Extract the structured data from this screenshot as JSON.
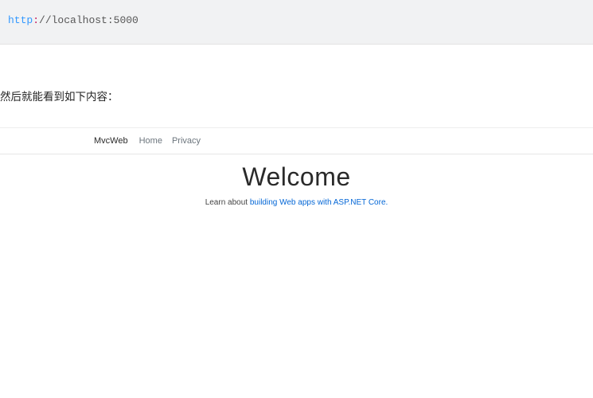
{
  "url": {
    "scheme": "http",
    "colon": ":",
    "rest": "//localhost:5000"
  },
  "caption": "然后就能看到如下内容：",
  "nav": {
    "brand": "MvcWeb",
    "links": [
      "Home",
      "Privacy"
    ]
  },
  "hero": {
    "title": "Welcome",
    "sub_prefix": "Learn about ",
    "sub_link": "building Web apps with ASP.NET Core.",
    "sub_suffix": ""
  }
}
